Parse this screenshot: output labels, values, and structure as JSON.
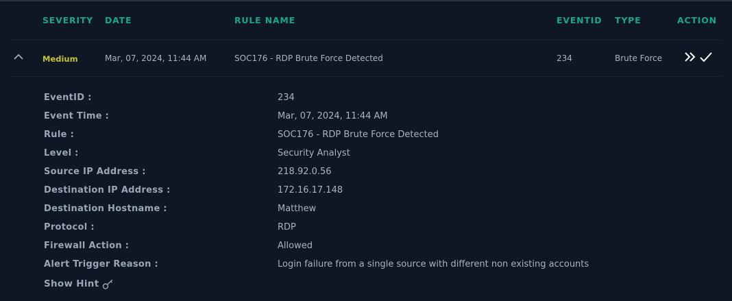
{
  "table": {
    "headers": {
      "severity": "SEVERITY",
      "date": "DATE",
      "rule_name": "RULE NAME",
      "eventid": "EVENTID",
      "type": "TYPE",
      "action": "ACTION"
    },
    "row": {
      "severity": "Medium",
      "date": "Mar, 07, 2024, 11:44 AM",
      "rule_name": "SOC176 - RDP Brute Force Detected",
      "eventid": "234",
      "type": "Brute Force"
    }
  },
  "details": [
    {
      "label": "EventID :",
      "value": "234"
    },
    {
      "label": "Event Time :",
      "value": "Mar, 07, 2024, 11:44 AM"
    },
    {
      "label": "Rule :",
      "value": "SOC176 - RDP Brute Force Detected"
    },
    {
      "label": "Level :",
      "value": "Security Analyst"
    },
    {
      "label": "Source IP Address :",
      "value": "218.92.0.56"
    },
    {
      "label": "Destination IP Address :",
      "value": "172.16.17.148"
    },
    {
      "label": "Destination Hostname :",
      "value": "Matthew"
    },
    {
      "label": "Protocol :",
      "value": "RDP"
    },
    {
      "label": "Firewall Action :",
      "value": "Allowed"
    },
    {
      "label": "Alert Trigger Reason :",
      "value": "Login failure from a single source with different non existing accounts"
    }
  ],
  "hint": {
    "label": "Show Hint",
    "icon": "key-icon"
  },
  "colors": {
    "background": "#0f1724",
    "header_accent": "#17a58b",
    "severity_medium": "#c7c236"
  },
  "icons": {
    "collapse": "chevron-up-icon",
    "escalate": "double-chevron-right-icon",
    "close_alert": "check-icon"
  }
}
